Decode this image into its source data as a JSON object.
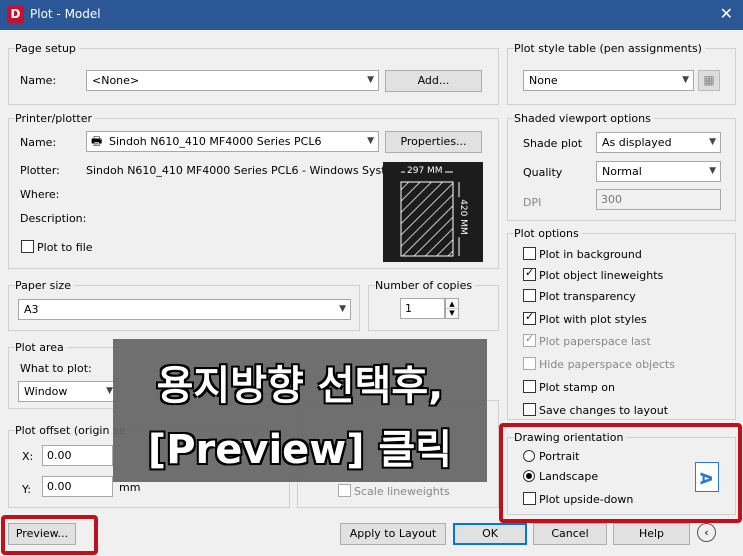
{
  "window": {
    "title": "Plot - Model",
    "app_icon": "D"
  },
  "page_setup": {
    "group_label": "Page setup",
    "name_label": "Name:",
    "name_value": "<None>",
    "add_button": "Add..."
  },
  "printer": {
    "group_label": "Printer/plotter",
    "name_label": "Name:",
    "name_value": "Sindoh N610_410 MF4000 Series PCL6",
    "properties_button": "Properties...",
    "plotter_label": "Plotter:",
    "plotter_value": "Sindoh N610_410 MF4000 Series PCL6 - Windows Syste...",
    "where_label": "Where:",
    "description_label": "Description:",
    "plot_to_file": "Plot to file",
    "preview_width": "297 MM",
    "preview_height": "420 MM"
  },
  "paper_size": {
    "group_label": "Paper size",
    "value": "A3"
  },
  "copies": {
    "group_label": "Number of copies",
    "value": "1"
  },
  "plot_area": {
    "group_label": "Plot area",
    "what_label": "What to plot:",
    "what_value": "Window"
  },
  "plot_offset": {
    "group_label": "Plot offset (origin se",
    "x_label": "X:",
    "x_value": "0.00",
    "y_label": "Y:",
    "y_value": "0.00",
    "unit": "mm"
  },
  "scale": {
    "scale_lineweights": "Scale lineweights"
  },
  "style_table": {
    "group_label": "Plot style table (pen assignments)",
    "value": "None"
  },
  "shaded": {
    "group_label": "Shaded viewport options",
    "shade_label": "Shade plot",
    "shade_value": "As displayed",
    "quality_label": "Quality",
    "quality_value": "Normal",
    "dpi_label": "DPI",
    "dpi_value": "300"
  },
  "plot_options": {
    "group_label": "Plot options",
    "background": "Plot in background",
    "lineweights": "Plot object lineweights",
    "transparency": "Plot transparency",
    "styles": "Plot with plot styles",
    "paperspace_last": "Plot paperspace last",
    "hide_paperspace": "Hide paperspace objects",
    "stamp": "Plot stamp on",
    "save_changes": "Save changes to layout"
  },
  "orientation": {
    "group_label": "Drawing orientation",
    "portrait": "Portrait",
    "landscape": "Landscape",
    "upside_down": "Plot upside-down",
    "icon_letter": "A"
  },
  "buttons": {
    "preview": "Preview...",
    "apply": "Apply to Layout",
    "ok": "OK",
    "cancel": "Cancel",
    "help": "Help"
  },
  "overlay": {
    "line1": "용지방향 선택후,",
    "line2": "[Preview] 클릭"
  },
  "colors": {
    "titlebar": "#2b5797",
    "highlight": "#c0101a",
    "accent": "#0078d7"
  }
}
